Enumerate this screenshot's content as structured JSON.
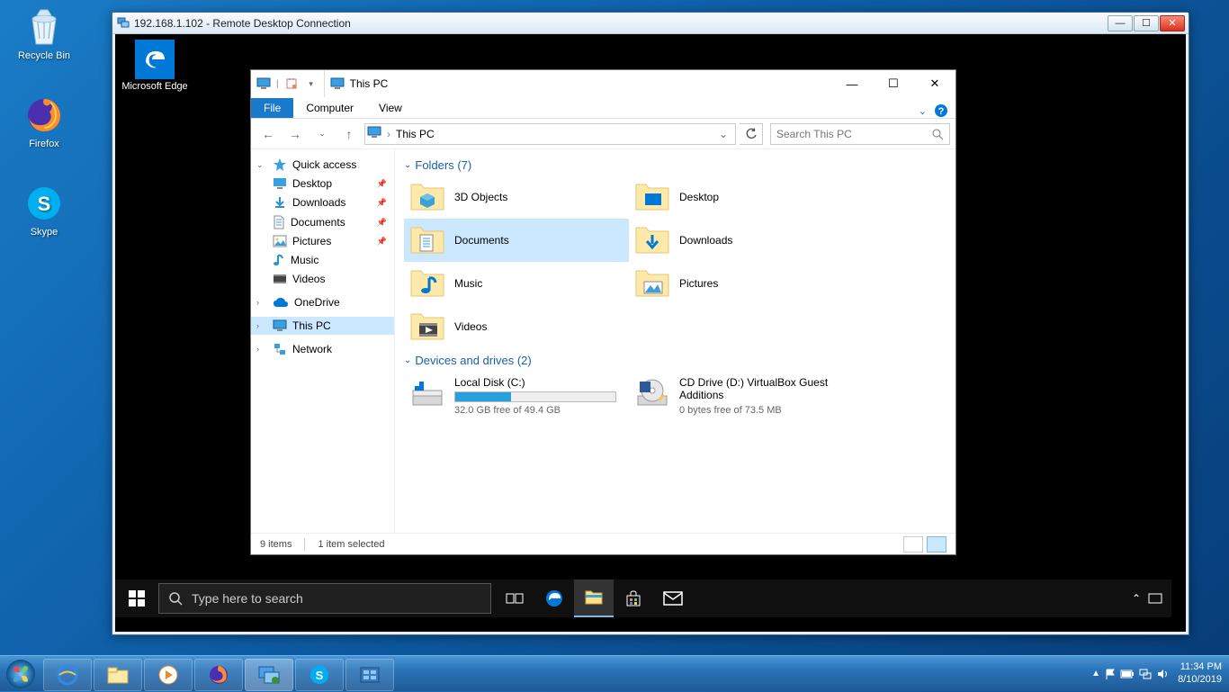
{
  "host_desktop_icons": {
    "recycle": "Recycle Bin",
    "firefox": "Firefox",
    "skype": "Skype"
  },
  "host_tray": {
    "time": "11:34 PM",
    "date": "8/10/2019"
  },
  "rdc": {
    "title": "192.168.1.102 - Remote Desktop Connection"
  },
  "remote": {
    "desktop_icons": {
      "edge": "Microsoft Edge"
    },
    "search_placeholder": "Type here to search"
  },
  "explorer": {
    "title": "This PC",
    "tabs": {
      "file": "File",
      "computer": "Computer",
      "view": "View"
    },
    "address": {
      "location": "This PC"
    },
    "search_placeholder": "Search This PC",
    "nav": {
      "quick_access": "Quick access",
      "desktop": "Desktop",
      "downloads": "Downloads",
      "documents": "Documents",
      "pictures": "Pictures",
      "music": "Music",
      "videos": "Videos",
      "onedrive": "OneDrive",
      "thispc": "This PC",
      "network": "Network"
    },
    "groups": {
      "folders": "Folders (7)",
      "drives": "Devices and drives (2)"
    },
    "folders": {
      "3dobjects": "3D Objects",
      "desktop": "Desktop",
      "documents": "Documents",
      "downloads": "Downloads",
      "music": "Music",
      "pictures": "Pictures",
      "videos": "Videos"
    },
    "drives": {
      "c": {
        "name": "Local Disk (C:)",
        "free": "32.0 GB free of 49.4 GB",
        "fill_pct": 35
      },
      "d": {
        "name": "CD Drive (D:) VirtualBox Guest Additions",
        "free": "0 bytes free of 73.5 MB"
      }
    },
    "status": {
      "count": "9 items",
      "selected": "1 item selected"
    }
  }
}
